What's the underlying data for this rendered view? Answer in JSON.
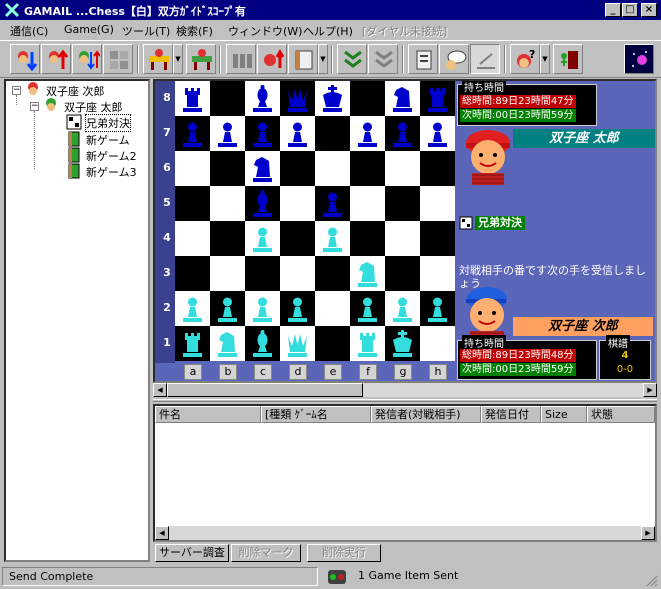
{
  "window": {
    "title": "GAMAIL ...Chess【白】双方ｶﾞｲﾄﾞｽｺｰﾌﾟ有",
    "minimize": "_",
    "maximize": "□",
    "close": "×"
  },
  "menu": [
    {
      "label": "通信(C)",
      "enabled": true
    },
    {
      "label": "Game(G)",
      "enabled": true
    },
    {
      "label": "ツール(T)",
      "enabled": true
    },
    {
      "label": "検索(F)",
      "enabled": true
    },
    {
      "label": "ウィンドウ(W)",
      "enabled": true
    },
    {
      "label": "ヘルプ(H)",
      "enabled": true
    },
    {
      "label": "[ダイヤル未接続]",
      "enabled": false
    }
  ],
  "toolbar": {
    "icons": [
      "receive-mail-icon",
      "send-mail-icon",
      "send-receive-icon",
      "puzzle-icon",
      "game-table-icon",
      "game-table-2-icon",
      "players-icon",
      "player-up-icon",
      "notebook-icon",
      "tree-list-icon",
      "tree-list-2-icon",
      "document-icon",
      "chat-bubble-icon",
      "pressed-tool-icon",
      "help-person-icon",
      "exit-door-icon",
      "space-icon"
    ]
  },
  "tree": {
    "items": [
      {
        "label": "双子座 次郎",
        "level": 0,
        "expander": "−",
        "icon": "player-red-icon"
      },
      {
        "label": "双子座 太郎",
        "level": 1,
        "expander": "−",
        "icon": "player-green-icon"
      },
      {
        "label": "兄弟対決",
        "level": 2,
        "icon": "board-icon",
        "selected": true
      },
      {
        "label": "新ゲーム",
        "level": 2,
        "icon": "book-icon"
      },
      {
        "label": "新ゲーム2",
        "level": 2,
        "icon": "book-icon"
      },
      {
        "label": "新ゲーム3",
        "level": 2,
        "icon": "book-icon"
      }
    ]
  },
  "board": {
    "ranks": [
      "8",
      "7",
      "6",
      "5",
      "4",
      "3",
      "2",
      "1"
    ],
    "files": [
      "a",
      "b",
      "c",
      "d",
      "e",
      "f",
      "g",
      "h"
    ],
    "squares": [
      [
        "bR",
        "",
        "bB",
        "bQ",
        "bK",
        "",
        "bN",
        "bR"
      ],
      [
        "bP",
        "bP",
        "bP",
        "bP",
        "",
        "bP",
        "bP",
        "bP"
      ],
      [
        "",
        "",
        "bN",
        "",
        "",
        "",
        "",
        ""
      ],
      [
        "",
        "",
        "bB",
        "",
        "bP",
        "",
        "",
        ""
      ],
      [
        "",
        "",
        "wP",
        "",
        "wP",
        "",
        "",
        ""
      ],
      [
        "",
        "",
        "",
        "",
        "",
        "wN",
        "",
        ""
      ],
      [
        "wP",
        "wP",
        "wP",
        "wP",
        "",
        "wP",
        "wP",
        "wP"
      ],
      [
        "wR",
        "wN",
        "wB",
        "wQ",
        "",
        "wR",
        "wK",
        ""
      ]
    ]
  },
  "opponent_panel": {
    "time_title": "持ち時間",
    "total_label": "総時間:",
    "total_value": "89日23時間47分",
    "next_label": "次時間:",
    "next_value": "00日23時間59分",
    "player_name": "双子座 太郎"
  },
  "game_label": "兄弟対決",
  "message": "対戦相手の番です次の手を受信しましょう",
  "self_panel": {
    "player_name": "双子座 次郎",
    "time_title": "持ち時間",
    "total_label": "総時間:",
    "total_value": "89日23時間48分",
    "next_label": "次時間:",
    "next_value": "00日23時間59分",
    "record_title": "棋譜",
    "record_moves": "4",
    "record_score": "0-0"
  },
  "colors": {
    "board_bg": "#5c66b8",
    "black_piece": "#0000cc",
    "white_piece": "#33dddd",
    "timer_red": "#c00000",
    "timer_green": "#008000",
    "name_teal": "#008080",
    "name_orange": "#ffa060"
  },
  "list": {
    "columns": [
      "件名",
      "[種類 ｹﾞｰﾑ名",
      "発信者(対戦相手)",
      "発信日付",
      "Size",
      "状態"
    ],
    "rows": []
  },
  "buttons": [
    {
      "label": "サーバー調査",
      "enabled": true
    },
    {
      "label": "削除マーク",
      "enabled": false
    },
    {
      "label": "削除実行",
      "enabled": false
    }
  ],
  "status": {
    "left": "Send Complete",
    "right": "1 Game Item Sent"
  }
}
